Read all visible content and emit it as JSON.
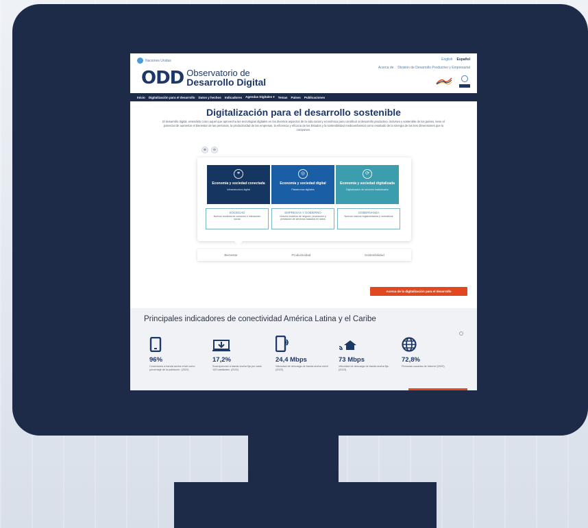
{
  "colors": {
    "monitor": "#1d2a48",
    "navbar": "#1d2a48",
    "accent": "#e0491f",
    "pillar1": "#153660",
    "pillar2": "#1a5fa5",
    "pillar3": "#3b9dad"
  },
  "header": {
    "org_name": "Naciones Unidas",
    "logo_mark": "ODD",
    "logo_line1": "Observatorio de",
    "logo_line2": "Desarrollo Digital",
    "lang_en": "English",
    "lang_es": "Español",
    "link_about": "Acerca de",
    "link_division": "División de Desarrollo Productivo y Empresarial"
  },
  "nav": {
    "items": [
      "Inicio",
      "Digitalización para el desarrollo",
      "Datos y hechos",
      "Indicadores",
      "Agendas Digitales ▾",
      "Temas",
      "Países",
      "Publicaciones"
    ]
  },
  "main": {
    "title": "Digitalización para el desarrollo sostenible",
    "intro": "El desarrollo digital, entendido como aquel que aprovecha las tecnologías digitales en los diversos aspectos de la vida social y económica para contribuir al desarrollo productivo, inclusivo y sostenible de los países, tiene el potencial de aumentar el bienestar de las personas, la productividad de las empresas, la eficiencia y eficacia de los Estados y la sostenibilidad medioambiental como resultado de la sinergia de las tres dimensiones que lo componen."
  },
  "diagram": {
    "pillars": [
      {
        "title": "Economía y sociedad conectada",
        "subtitle": "Infraestructura digital",
        "icon": "network-icon"
      },
      {
        "title": "Economía y sociedad digital",
        "subtitle": "Plataformas digitales",
        "icon": "globe-icon"
      },
      {
        "title": "Economía y sociedad digitalizada",
        "subtitle": "Digitalización de sectores tradicionales",
        "icon": "transform-icon"
      }
    ],
    "dimensions": [
      {
        "title": "SOCIEDAD",
        "desc": "Nuevos modelos de consumo e interacción social"
      },
      {
        "title": "EMPRESAS Y GOBIERNO",
        "desc": "Nuevos modelos de negocio, producción y prestación de servicios basados en datos"
      },
      {
        "title": "GOBERNANZA",
        "desc": "Nuevos marcos reglamentarios y normativos"
      }
    ],
    "outcomes": [
      "Bienestar",
      "Productividad",
      "Sostenibilidad"
    ]
  },
  "cta": {
    "label": "Acerca de la digitalización para el desarrollo"
  },
  "indicators": {
    "title": "Principales indicadores de conectividad América Latina y el Caribe",
    "items": [
      {
        "value": "96%",
        "label": "Conexiones a banda ancha móvil como porcentaje de la población. (2022)",
        "icon": "tablet-icon"
      },
      {
        "value": "17,2%",
        "label": "Suscripciones a banda ancha fija por cada 100 habitantes. (2022)",
        "icon": "download-icon"
      },
      {
        "value": "24,4 Mbps",
        "label": "Velocidad de descarga de banda ancha móvil (2023)",
        "icon": "mobile-signal-icon"
      },
      {
        "value": "73 Mbps",
        "label": "Velocidad de descarga de banda ancha fija. (2023)",
        "icon": "home-wifi-icon"
      },
      {
        "value": "72,8%",
        "label": "Personas usuarias de Internet (2022)",
        "icon": "globe-icon"
      }
    ]
  }
}
